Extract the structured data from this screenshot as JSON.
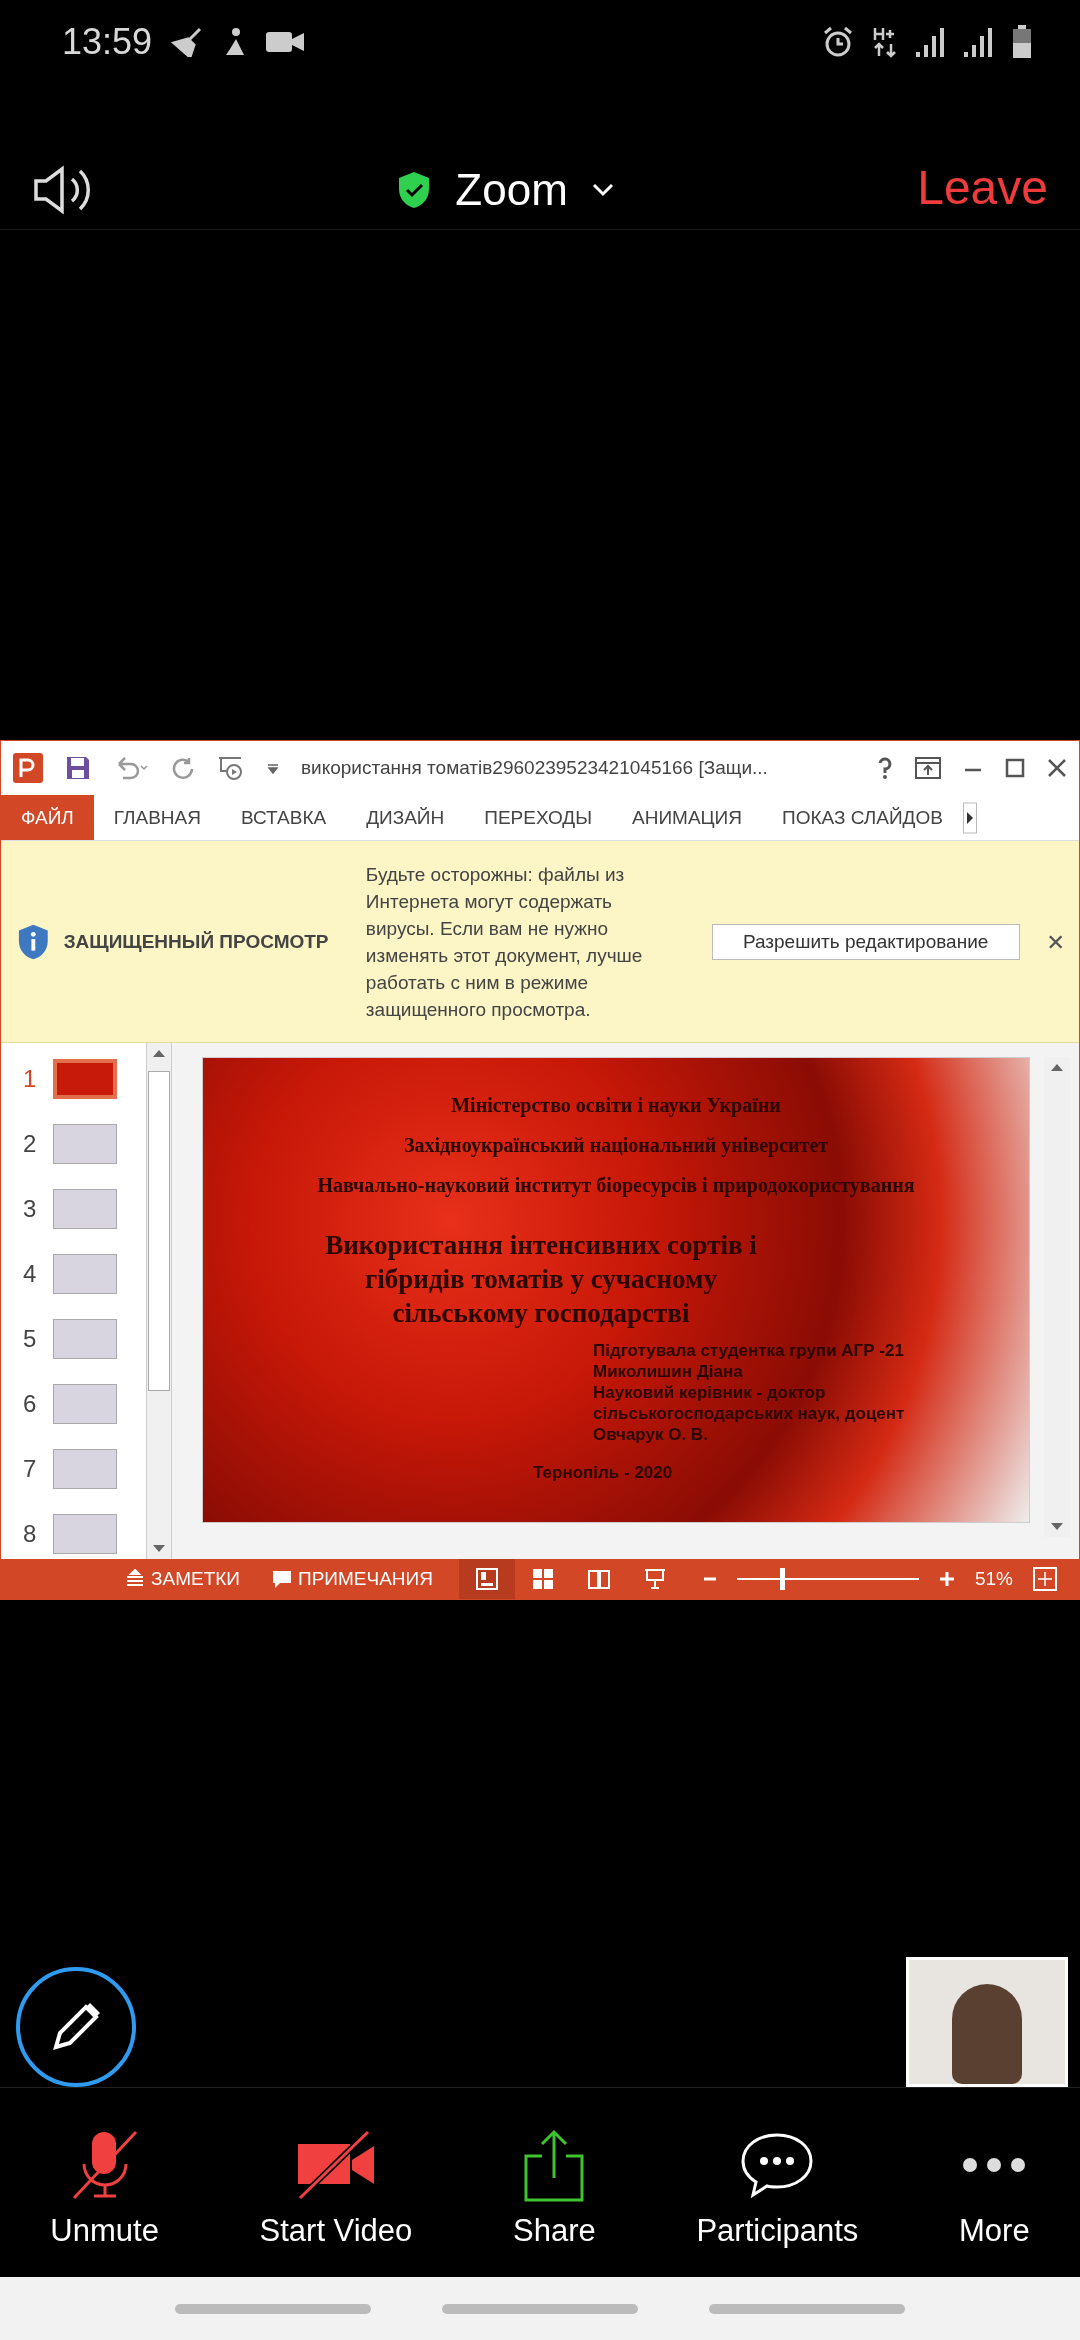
{
  "status_bar": {
    "time": "13:59"
  },
  "header": {
    "title": "Zoom",
    "leave": "Leave"
  },
  "ppt": {
    "title": "використання томатів2960239523421045166 [Защи...",
    "ribbon_tabs": [
      {
        "label": "ФАЙЛ",
        "selected": true
      },
      {
        "label": "ГЛАВНАЯ",
        "selected": false
      },
      {
        "label": "ВСТАВКА",
        "selected": false
      },
      {
        "label": "ДИЗАЙН",
        "selected": false
      },
      {
        "label": "ПЕРЕХОДЫ",
        "selected": false
      },
      {
        "label": "АНИМАЦИЯ",
        "selected": false
      },
      {
        "label": "ПОКАЗ СЛАЙДОВ",
        "selected": false
      }
    ],
    "protected_view": {
      "heading": "ЗАЩИЩЕННЫЙ ПРОСМОТР",
      "message": "Будьте осторожны: файлы из Интернета могут содержать вирусы. Если вам не нужно изменять этот документ, лучше работать с ним в режиме защищенного просмотра.",
      "button": "Разрешить редактирование"
    },
    "slides": [
      {
        "number": "1",
        "selected": true
      },
      {
        "number": "2",
        "selected": false
      },
      {
        "number": "3",
        "selected": false
      },
      {
        "number": "4",
        "selected": false
      },
      {
        "number": "5",
        "selected": false
      },
      {
        "number": "6",
        "selected": false
      },
      {
        "number": "7",
        "selected": false
      },
      {
        "number": "8",
        "selected": false
      }
    ],
    "slide": {
      "org_lines": [
        "Міністерство освіти і науки України",
        "Західноукраїнський національний університет",
        "Навчально-науковий інститут біоресурсів і природокористування"
      ],
      "title_lines": [
        "Використання інтенсивних сортів і",
        "гібридів томатів у сучасному",
        "сільському господарстві"
      ],
      "author_lines": [
        "Підготувала студентка групи АГР -21",
        "Миколишин Діана",
        "Науковий керівник - доктор",
        "сільськогосподарських наук, доцент",
        " Овчарук О. В."
      ],
      "footer": "Тернопіль - 2020"
    },
    "status": {
      "notes": "ЗАМЕТКИ",
      "comments": "ПРИМЕЧАНИЯ",
      "views": [
        {
          "kind": "normal",
          "selected": true
        },
        {
          "kind": "sorter",
          "selected": false
        },
        {
          "kind": "reading",
          "selected": false
        },
        {
          "kind": "show",
          "selected": false
        }
      ],
      "zoom": {
        "level": 0.25,
        "reading": "51%"
      }
    }
  },
  "toolbar": [
    {
      "kind": "mic",
      "label": "Unmute"
    },
    {
      "kind": "video",
      "label": "Start Video"
    },
    {
      "kind": "share",
      "label": "Share"
    },
    {
      "kind": "chat",
      "label": "Participants"
    },
    {
      "kind": "more",
      "label": "More"
    }
  ]
}
